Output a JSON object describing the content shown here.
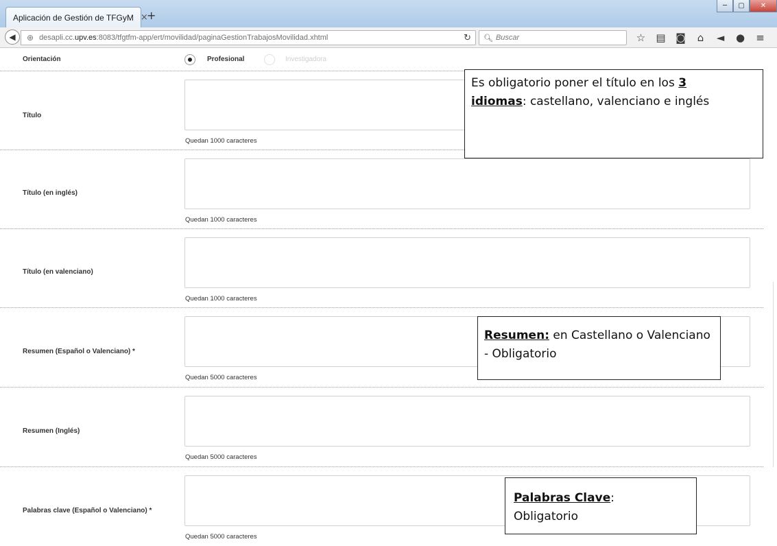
{
  "browser": {
    "tab_title": "Aplicación de Gestión de TFGyM",
    "tab_close": "×",
    "new_tab": "+",
    "url_prefix": "desapli.cc.",
    "url_host": "upv.es",
    "url_rest": ":8083/tfgtfm-app/ert/movilidad/paginaGestionTrabajosMovilidad.xhtml",
    "search_placeholder": "Buscar",
    "window_buttons": [
      "─",
      "▢",
      "✕"
    ],
    "toolbar_icons": [
      "star-icon",
      "reading-list-icon",
      "pocket-icon",
      "home-icon",
      "send-icon",
      "chat-icon",
      "menu-icon"
    ]
  },
  "form": {
    "orientation": {
      "label": "Orientación",
      "options": [
        {
          "label": "Profesional",
          "checked": true,
          "disabled": false
        },
        {
          "label": "Investigadora",
          "checked": false,
          "disabled": true
        }
      ]
    },
    "fields": [
      {
        "label": "Título",
        "counter": "Quedan 1000 caracteres"
      },
      {
        "label": "Título (en inglés)",
        "counter": "Quedan 1000 caracteres"
      },
      {
        "label": "Título (en valenciano)",
        "counter": "Quedan 1000 caracteres"
      },
      {
        "label": "Resumen (Español o Valenciano) *",
        "counter": "Quedan 5000 caracteres"
      },
      {
        "label": "Resumen (Inglés)",
        "counter": "Quedan 5000 caracteres"
      },
      {
        "label": "Palabras clave (Español o Valenciano) *",
        "counter": "Quedan 5000 caracteres"
      }
    ]
  },
  "notes": {
    "titulo": {
      "text_1": "Es obligatorio poner el título en los ",
      "bold_1": "3",
      "bold_2": "idiomas",
      "text_2": ": castellano, valenciano e inglés"
    },
    "resumen": {
      "bold": "Resumen:",
      "text": " en Castellano o Valenciano - Obligatorio"
    },
    "palabras": {
      "bold": "Palabras Clave",
      "text_1": ":",
      "text_2": "Obligatorio"
    }
  }
}
